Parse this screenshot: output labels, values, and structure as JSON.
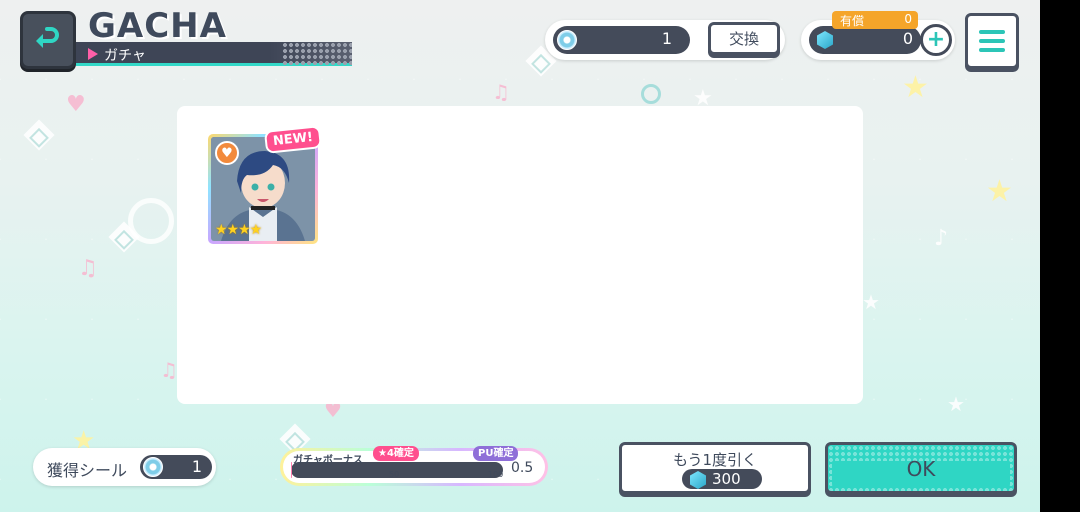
{
  "header": {
    "title": "GACHA",
    "subtitle": "ガチャ"
  },
  "currency": {
    "stickers": "1",
    "exchange_label": "交換",
    "paid_label": "有償",
    "paid_value": "0",
    "gems": "0",
    "plus_label": "+"
  },
  "result": {
    "cards": [
      {
        "new_label": "NEW!",
        "stars": "★★★★",
        "rarity": 4
      }
    ]
  },
  "footer": {
    "sticker_label": "獲得シール",
    "sticker_count": "1",
    "bonus_title": "ガチャボーナス",
    "bonus_tag_4star": "★4確定",
    "bonus_tag_pu": "PU確定",
    "bonus_tick_50": "50",
    "bonus_tick_100": "100",
    "bonus_value": "0.5",
    "bonus_progress_percent": 0.5,
    "again_label": "もう1度引く",
    "again_cost": "300",
    "ok_label": "OK"
  },
  "colors": {
    "accent": "#2fd6c4",
    "dark": "#444b5a",
    "pink": "#ff4f8e",
    "orange": "#f5a52a"
  }
}
